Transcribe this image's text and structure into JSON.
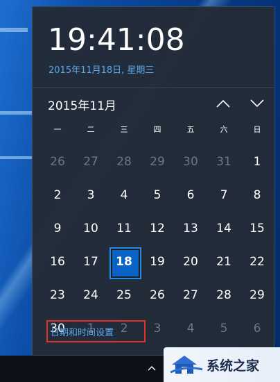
{
  "clock": {
    "time": "19:41:08",
    "long_date": "2015年11月18日, 星期三"
  },
  "calendar": {
    "month_title": "2015年11月",
    "weekdays": [
      "一",
      "二",
      "三",
      "四",
      "五",
      "六",
      "日"
    ],
    "days": [
      {
        "d": "26",
        "dim": true
      },
      {
        "d": "27",
        "dim": true
      },
      {
        "d": "28",
        "dim": true
      },
      {
        "d": "29",
        "dim": true
      },
      {
        "d": "30",
        "dim": true
      },
      {
        "d": "31",
        "dim": true
      },
      {
        "d": "1"
      },
      {
        "d": "2"
      },
      {
        "d": "3"
      },
      {
        "d": "4"
      },
      {
        "d": "5"
      },
      {
        "d": "6"
      },
      {
        "d": "7"
      },
      {
        "d": "8"
      },
      {
        "d": "9"
      },
      {
        "d": "10"
      },
      {
        "d": "11"
      },
      {
        "d": "12"
      },
      {
        "d": "13"
      },
      {
        "d": "14"
      },
      {
        "d": "15"
      },
      {
        "d": "16"
      },
      {
        "d": "17"
      },
      {
        "d": "18",
        "today": true
      },
      {
        "d": "19"
      },
      {
        "d": "20"
      },
      {
        "d": "21"
      },
      {
        "d": "22"
      },
      {
        "d": "23"
      },
      {
        "d": "24"
      },
      {
        "d": "25"
      },
      {
        "d": "26"
      },
      {
        "d": "27"
      },
      {
        "d": "28"
      },
      {
        "d": "29"
      },
      {
        "d": "30"
      },
      {
        "d": "1",
        "dim": true
      },
      {
        "d": "2",
        "dim": true
      },
      {
        "d": "3",
        "dim": true
      },
      {
        "d": "4",
        "dim": true
      },
      {
        "d": "5",
        "dim": true
      },
      {
        "d": "6",
        "dim": true
      }
    ]
  },
  "footer": {
    "settings_link": "日期和时间设置"
  },
  "icons": {
    "nav_up": "chevron-up-icon",
    "nav_down": "chevron-down-icon",
    "tray": "tray-expand-icon"
  },
  "watermark": {
    "text": "系统之家"
  },
  "colors": {
    "accent": "#0a64c6",
    "link": "#5ba8ea",
    "highlight_box": "#e0312c",
    "panel": "#232b37"
  }
}
